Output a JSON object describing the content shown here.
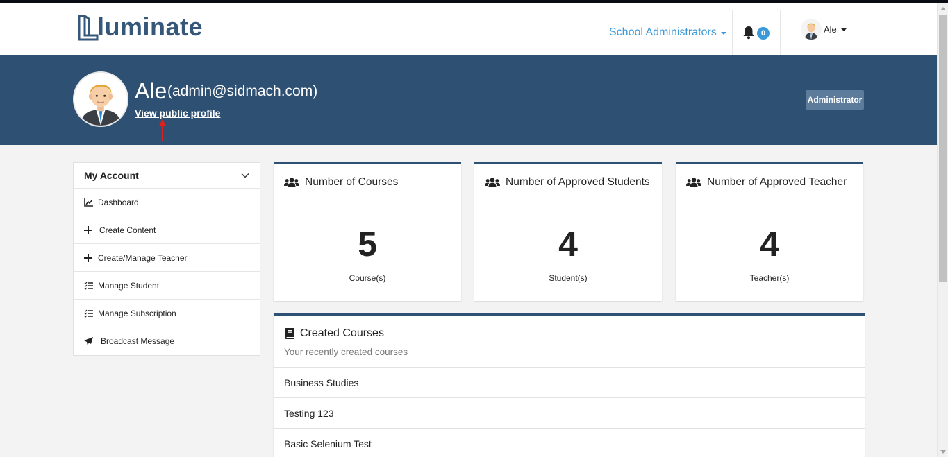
{
  "brand": {
    "logo_text": "luminate",
    "accent": "#3a9ad9",
    "primary": "#2e5072"
  },
  "navbar": {
    "role_menu_label": "School Administrators",
    "notification_count": "0",
    "user_name": "Ale"
  },
  "profile": {
    "name": "Ale",
    "email": "(admin@sidmach.com)",
    "view_profile_link": "View public profile",
    "role_badge": "Administrator"
  },
  "sidebar": {
    "title": "My Account",
    "items": [
      {
        "label": "Dashboard",
        "icon": "line-chart-icon"
      },
      {
        "label": "Create Content",
        "icon": "plus-icon"
      },
      {
        "label": "Create/Manage Teacher",
        "icon": "plus-icon"
      },
      {
        "label": "Manage Student",
        "icon": "list-icon"
      },
      {
        "label": "Manage Subscription",
        "icon": "list-icon"
      },
      {
        "label": "Broadcast Message",
        "icon": "paper-plane-icon"
      }
    ]
  },
  "stats": [
    {
      "title": "Number of Courses",
      "value": "5",
      "unit": "Course(s)",
      "icon": "users-icon"
    },
    {
      "title": "Number of Approved Students",
      "value": "4",
      "unit": "Student(s)",
      "icon": "users-icon"
    },
    {
      "title": "Number of Approved Teacher",
      "value": "4",
      "unit": "Teacher(s)",
      "icon": "users-icon"
    }
  ],
  "created_courses": {
    "title": "Created Courses",
    "subtitle": "Your recently created courses",
    "rows": [
      "Business Studies",
      "Testing 123",
      "Basic Selenium Test"
    ]
  }
}
